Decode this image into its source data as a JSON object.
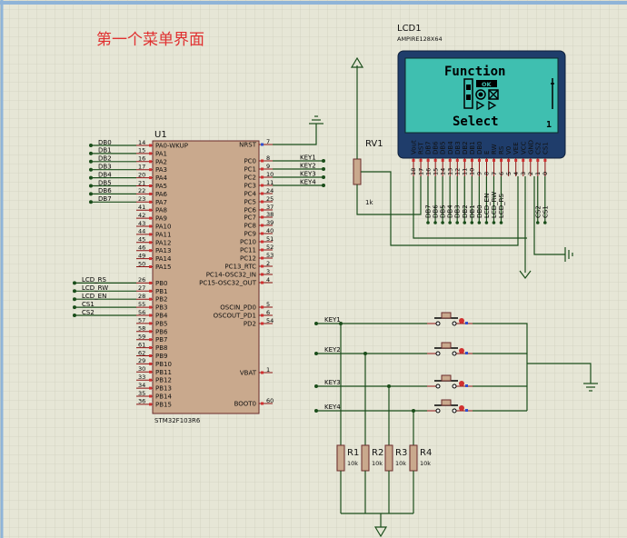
{
  "title": "第一个菜单界面",
  "mcu": {
    "ref": "U1",
    "part": "STM32F103R6",
    "left_pins": [
      {
        "num": "14",
        "name": "PA0-WKUP",
        "net": "DB0"
      },
      {
        "num": "15",
        "name": "PA1",
        "net": "DB1"
      },
      {
        "num": "16",
        "name": "PA2",
        "net": "DB2"
      },
      {
        "num": "17",
        "name": "PA3",
        "net": "DB3"
      },
      {
        "num": "20",
        "name": "PA4",
        "net": "DB4"
      },
      {
        "num": "21",
        "name": "PA5",
        "net": "DB5"
      },
      {
        "num": "22",
        "name": "PA6",
        "net": "DB6"
      },
      {
        "num": "23",
        "name": "PA7",
        "net": "DB7"
      },
      {
        "num": "41",
        "name": "PA8",
        "net": ""
      },
      {
        "num": "42",
        "name": "PA9",
        "net": ""
      },
      {
        "num": "43",
        "name": "PA10",
        "net": ""
      },
      {
        "num": "44",
        "name": "PA11",
        "net": ""
      },
      {
        "num": "45",
        "name": "PA12",
        "net": ""
      },
      {
        "num": "46",
        "name": "PA13",
        "net": ""
      },
      {
        "num": "49",
        "name": "PA14",
        "net": ""
      },
      {
        "num": "50",
        "name": "PA15",
        "net": ""
      },
      {
        "num": "26",
        "name": "PB0",
        "net": "LCD_RS"
      },
      {
        "num": "27",
        "name": "PB1",
        "net": "LCD_RW"
      },
      {
        "num": "28",
        "name": "PB2",
        "net": "LCD_EN"
      },
      {
        "num": "55",
        "name": "PB3",
        "net": "CS1"
      },
      {
        "num": "56",
        "name": "PB4",
        "net": "CS2"
      },
      {
        "num": "57",
        "name": "PB5",
        "net": ""
      },
      {
        "num": "58",
        "name": "PB6",
        "net": ""
      },
      {
        "num": "59",
        "name": "PB7",
        "net": ""
      },
      {
        "num": "61",
        "name": "PB8",
        "net": ""
      },
      {
        "num": "62",
        "name": "PB9",
        "net": ""
      },
      {
        "num": "29",
        "name": "PB10",
        "net": ""
      },
      {
        "num": "30",
        "name": "PB11",
        "net": ""
      },
      {
        "num": "33",
        "name": "PB12",
        "net": ""
      },
      {
        "num": "34",
        "name": "PB13",
        "net": ""
      },
      {
        "num": "35",
        "name": "PB14",
        "net": ""
      },
      {
        "num": "36",
        "name": "PB15",
        "net": ""
      }
    ],
    "right_pins": [
      {
        "num": "7",
        "name": "NRST",
        "net": ""
      },
      {
        "num": "8",
        "name": "PC0",
        "net": "KEY1"
      },
      {
        "num": "9",
        "name": "PC1",
        "net": "KEY2"
      },
      {
        "num": "10",
        "name": "PC2",
        "net": "KEY3"
      },
      {
        "num": "11",
        "name": "PC3",
        "net": "KEY4"
      },
      {
        "num": "24",
        "name": "PC4",
        "net": ""
      },
      {
        "num": "25",
        "name": "PC5",
        "net": ""
      },
      {
        "num": "37",
        "name": "PC6",
        "net": ""
      },
      {
        "num": "38",
        "name": "PC7",
        "net": ""
      },
      {
        "num": "39",
        "name": "PC8",
        "net": ""
      },
      {
        "num": "40",
        "name": "PC9",
        "net": ""
      },
      {
        "num": "51",
        "name": "PC10",
        "net": ""
      },
      {
        "num": "52",
        "name": "PC11",
        "net": ""
      },
      {
        "num": "53",
        "name": "PC12",
        "net": ""
      },
      {
        "num": "2",
        "name": "PC13_RTC",
        "net": ""
      },
      {
        "num": "3",
        "name": "PC14-OSC32_IN",
        "net": ""
      },
      {
        "num": "4",
        "name": "PC15-OSC32_OUT",
        "net": ""
      },
      {
        "num": "5",
        "name": "OSCIN_PD0",
        "net": ""
      },
      {
        "num": "6",
        "name": "OSCOUT_PD1",
        "net": ""
      },
      {
        "num": "54",
        "name": "PD2",
        "net": ""
      },
      {
        "num": "1",
        "name": "VBAT",
        "net": ""
      },
      {
        "num": "60",
        "name": "BOOT0",
        "net": ""
      }
    ]
  },
  "lcd": {
    "ref": "LCD1",
    "part": "AMPIRE128X64",
    "screen_lines": [
      "Function",
      "Select"
    ],
    "ok_label": "OK",
    "page_number": "1",
    "pins": [
      {
        "num": "18",
        "name": "Vout"
      },
      {
        "num": "17",
        "name": "RST"
      },
      {
        "num": "16",
        "name": "DB7"
      },
      {
        "num": "15",
        "name": "DB6"
      },
      {
        "num": "14",
        "name": "DB5"
      },
      {
        "num": "13",
        "name": "DB4"
      },
      {
        "num": "12",
        "name": "DB3"
      },
      {
        "num": "11",
        "name": "DB2"
      },
      {
        "num": "10",
        "name": "DB1"
      },
      {
        "num": "9",
        "name": "DB0"
      },
      {
        "num": "8",
        "name": "E"
      },
      {
        "num": "7",
        "name": "RW"
      },
      {
        "num": "6",
        "name": "RS"
      },
      {
        "num": "5",
        "name": "V0"
      },
      {
        "num": "4",
        "name": "VEE"
      },
      {
        "num": "3",
        "name": "VCC"
      },
      {
        "num": "2",
        "name": "GND"
      },
      {
        "num": "1",
        "name": "CS2"
      },
      {
        "num": "0",
        "name": "CS1"
      }
    ],
    "bus_labels": [
      "DB7",
      "DB6",
      "DB5",
      "DB4",
      "DB3",
      "DB2",
      "DB1",
      "DB0",
      "LCD_EN",
      "LCD_RW",
      "LCD_RS",
      "",
      "",
      "",
      "",
      "CS2",
      "CS1"
    ]
  },
  "pot": {
    "ref": "RV1",
    "value": "1k"
  },
  "keys": [
    "KEY1",
    "KEY2",
    "KEY3",
    "KEY4"
  ],
  "resistors": [
    {
      "ref": "R1",
      "value": "10k"
    },
    {
      "ref": "R2",
      "value": "10k"
    },
    {
      "ref": "R3",
      "value": "10k"
    },
    {
      "ref": "R4",
      "value": "10k"
    }
  ],
  "colors": {
    "background": "#e6e6d6",
    "grid": "#c8c8b4",
    "wire": "#1a4d1a",
    "pin": "#8a1010",
    "chip": "#c9a98d",
    "lcd_screen": "#3fbfb0",
    "lcd_body": "#1f3d6b"
  }
}
